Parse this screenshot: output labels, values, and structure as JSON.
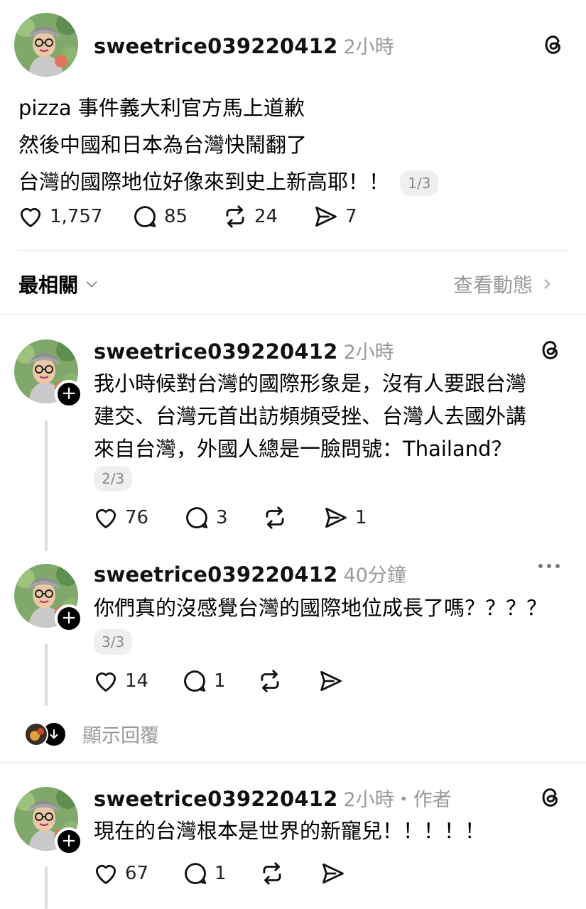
{
  "post": {
    "username": "sweetrice039220412",
    "time": "2小時",
    "lines": [
      "pizza 事件義大利官方馬上道歉",
      "然後中國和日本為台灣快鬧翻了",
      "台灣的國際地位好像來到史上新高耶！！"
    ],
    "pagination": "1/3",
    "likes": "1,757",
    "comments": "85",
    "reposts": "24",
    "shares": "7"
  },
  "sort_bar": {
    "label": "最相關",
    "activity_link": "查看動態"
  },
  "reply1": {
    "username": "sweetrice039220412",
    "time": "2小時",
    "lines": [
      "我小時候對台灣的國際形象是，沒有人要跟台灣",
      "建交、台灣元首出訪頻頻受挫、台灣人去國外講",
      "來自台灣，外國人總是一臉問號：Thailand？"
    ],
    "pagination": "2/3",
    "likes": "76",
    "comments": "3",
    "shares": "1"
  },
  "reply2": {
    "username": "sweetrice039220412",
    "time": "40分鐘",
    "lines": [
      "你們真的沒感覺台灣的國際地位成長了嗎？？？？"
    ],
    "pagination": "3/3",
    "likes": "14",
    "comments": "1"
  },
  "show_replies": {
    "label": "顯示回覆"
  },
  "reply3": {
    "username": "sweetrice039220412",
    "time": "2小時・作者",
    "lines": [
      "現在的台灣根本是世界的新寵兒！！！！！"
    ],
    "likes": "67",
    "comments": "1"
  },
  "colors": {
    "text": "#000000",
    "muted": "#999999",
    "divider": "#e2e2e2",
    "pill_bg": "#efefef"
  },
  "icons": [
    "heart-icon",
    "comment-icon",
    "repost-icon",
    "share-icon",
    "threads-logo-icon",
    "chevron-down-icon",
    "chevron-right-icon",
    "more-icon",
    "plus-icon",
    "arrow-down-icon"
  ]
}
